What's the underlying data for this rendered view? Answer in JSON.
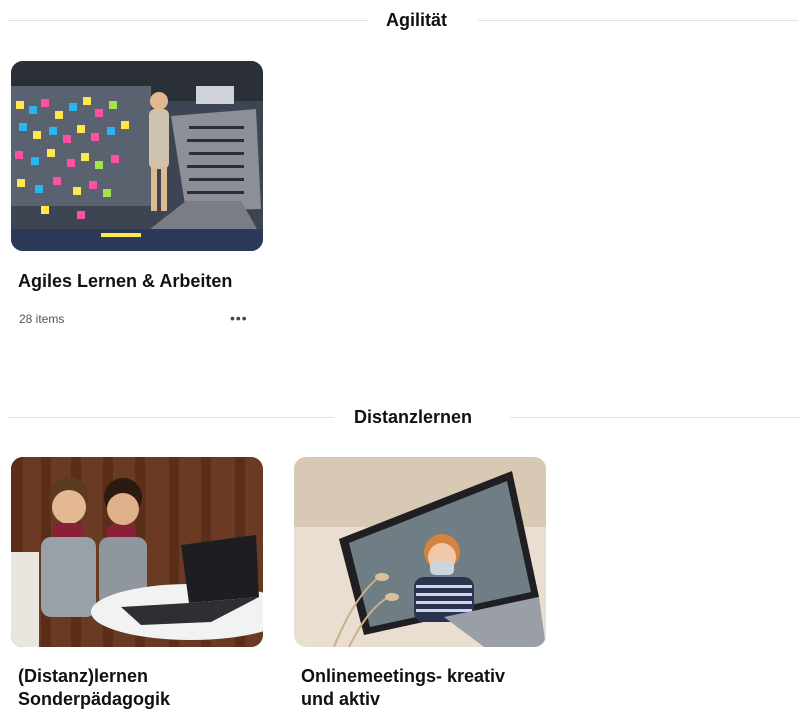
{
  "sections": [
    {
      "title": "Agilität",
      "cards": [
        {
          "title": "Agiles Lernen & Arbeiten",
          "items": "28 items",
          "more_icon": "more-horizontal-icon"
        }
      ]
    },
    {
      "title": "Distanzlernen",
      "cards": [
        {
          "title_line1": "(Distanz)lernen",
          "title_line2": "Sonderpädagogik"
        },
        {
          "title_line1": "Onlinemeetings- kreativ",
          "title_line2": "und aktiv"
        }
      ]
    }
  ],
  "more_glyph": "•••"
}
